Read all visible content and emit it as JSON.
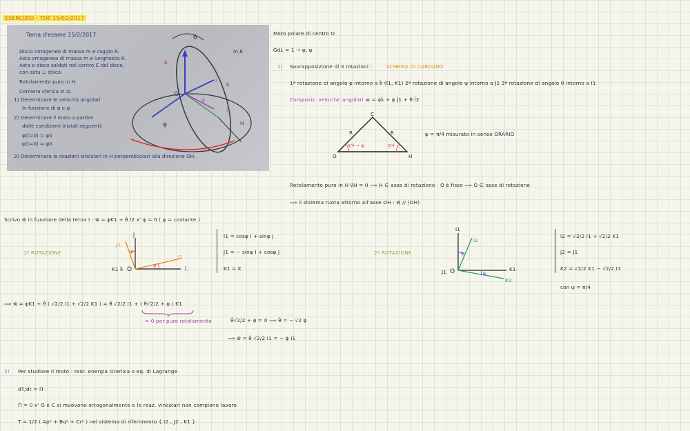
{
  "header": {
    "title": "ESERCIZIO - TDE 15/02/2017"
  },
  "photo": {
    "title": "Tema d'esame 15/2/2017",
    "lines": [
      "Disco omogeneo di massa m e raggio R.",
      "Asta omogenea di massa m e lunghezza R.",
      "Asta e disco saldati nel centro C del disco,",
      "con asta ⊥ disco.",
      "Rotolamento puro in H.",
      "Cerniera sferica in O."
    ],
    "questions": [
      "1) Determinare le velocità angolari",
      "in funzione di φ e ψ",
      "2) Determinare il moto a partire",
      "dalle condizioni iniziali seguenti:",
      "φ(t=0) = φ0",
      "ψ(t=0) = ψ0",
      "3) Determinare le reazioni vincolari in H perpendicolari alla direzione OH."
    ],
    "labels": {
      "theta": "θ",
      "mR": "m,R",
      "K": "K",
      "O": "O",
      "C": "C",
      "I": "I",
      "J": "J",
      "H": "H",
      "psi": "ψ",
      "phi": "φ"
    }
  },
  "right": {
    "line1": "Moto polare di centro O",
    "line2": "GdL = 1  →  φ, ψ",
    "item1_num": "1)",
    "item1_text": "Sovrapposizione di 3 rotazioni :",
    "item1_schema": "SCHEMA DI CARDANO",
    "rotations": "1ª rotazione di angolo φ intorno a k̂ (I1, K1)   2ª rotazione di angolo ψ intorno a J1   3ª rotazione di angolo θ intorno a I1",
    "composition": "Composiz. velocita' angolari :",
    "composition_eq": "w = φ̇k̂ + ψ̇ Ĵ1 + θ̇ Î2",
    "tri": {
      "C": "C",
      "R1": "R",
      "R2": "R",
      "O": "O",
      "H": "H",
      "angle_left": "π/4 = ψ",
      "angle_right": "π/4"
    },
    "psi_note": "ψ = π/4  misurato in senso ORARIO",
    "rolling": "Rotolamento puro in H  v⃗H = 0   ⟹   H ∈ asse di rotazione  ·  O è fisso  ⟹  O ∈ asse di rotazione",
    "rolling2": "⟹  il sistema ruota attorno all'asse OH  :  w⃗ // (OH)"
  },
  "mid": {
    "write": "Scrivo w⃗ in funzione della terna I  :   w⃗ = φ̇K1 + θ̇ I2        x' ψ̇ = 0   ( ψ = costante )",
    "rot1": "1ª ROTAZIONE",
    "rot2": "2ª ROTAZIONE",
    "eq1": [
      "I1 = cosφ I + sinφ J",
      "J1 = − sinφ I + cosφ J",
      "K1 = K"
    ],
    "eq2": [
      "I2 = √2/2 I1 + √2/2 K1",
      "J2 = J1",
      "K2 = √2/2 K1 − √2/2 I1"
    ],
    "with_psi": "con  ψ = π/4",
    "ax1": {
      "J": "Ĵ",
      "I": "Î",
      "K": "K1 k̂",
      "O": "O",
      "J1": "J1",
      "I1": "I1",
      "phi1": "φ",
      "phi2": "φ"
    },
    "ax2": {
      "I1": "I1",
      "I2": "I2",
      "J1": "J1",
      "O": "O",
      "K1": "K1",
      "K2": "K2",
      "psi1": "ψ",
      "psi2": "ψ"
    },
    "result1": "⟹ w⃗ = φ̇K1 + θ̇ ( √2/2 I1 + √2/2 K1 )  =  θ̇ √2/2 I1  +  ( θ̇√2/2 + φ̇ ) K1",
    "zero_note": "= 0  per puro rotolamento",
    "result2": "θ̇√2/2 + φ̇ = 0    ⟹    θ̇ = − √2 φ̇",
    "result3": "⟹   w⃗ = θ̇ √2/2 I1 = − φ̇ I1"
  },
  "bottom": {
    "num": "2)",
    "text": "Per studiare il moto : teor. energia cinetica o eq. di Lagrange",
    "dT": "dT/dt = Π",
    "pi_zero": "Π = 0   x'   O e C si muovono ortogonalmente e le reaz. vincolari non compiono lavoro",
    "T": "T = 1/2 ( Ap² + Bq² + Cr² )   nel sistema di riferimento  { I2 , J2 , K1 }"
  }
}
